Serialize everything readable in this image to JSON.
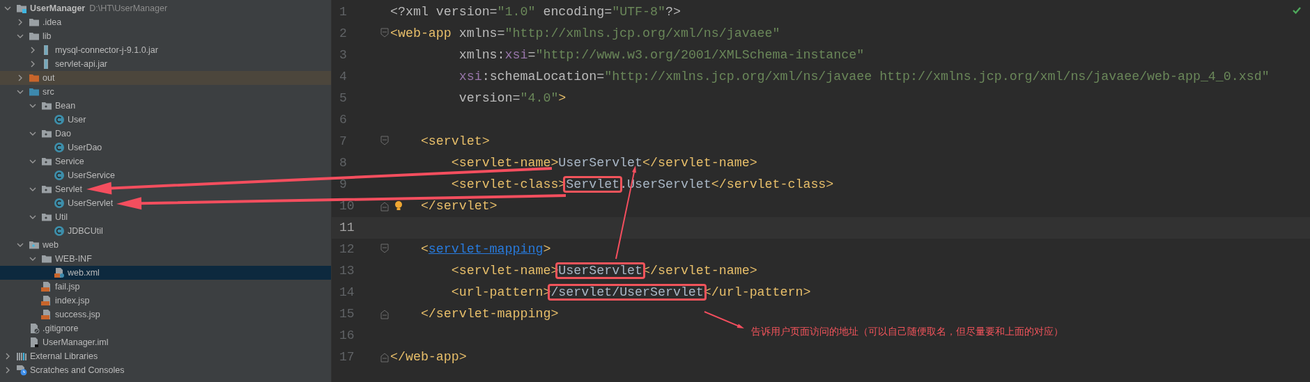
{
  "project_tree": [
    {
      "label": "UserManager",
      "path": "D:\\HT\\UserManager",
      "kind": "module",
      "expanded": true,
      "selected": false,
      "children": [
        {
          "label": ".idea",
          "kind": "folder",
          "expanded": false,
          "selected": false
        },
        {
          "label": "lib",
          "kind": "folder",
          "expanded": true,
          "selected": false,
          "children": [
            {
              "label": "mysql-connector-j-9.1.0.jar",
              "kind": "jar",
              "expanded": false,
              "selected": false
            },
            {
              "label": "servlet-api.jar",
              "kind": "jar",
              "expanded": false,
              "selected": false
            }
          ]
        },
        {
          "label": "out",
          "kind": "excluded-folder",
          "expanded": false,
          "selected": false
        },
        {
          "label": "src",
          "kind": "source-folder",
          "expanded": true,
          "selected": false,
          "children": [
            {
              "label": "Bean",
              "kind": "package",
              "expanded": true,
              "selected": false,
              "children": [
                {
                  "label": "User",
                  "kind": "class",
                  "selected": false
                }
              ]
            },
            {
              "label": "Dao",
              "kind": "package",
              "expanded": true,
              "selected": false,
              "children": [
                {
                  "label": "UserDao",
                  "kind": "class",
                  "selected": false
                }
              ]
            },
            {
              "label": "Service",
              "kind": "package",
              "expanded": true,
              "selected": false,
              "children": [
                {
                  "label": "UserService",
                  "kind": "class",
                  "selected": false
                }
              ]
            },
            {
              "label": "Servlet",
              "kind": "package",
              "expanded": true,
              "selected": false,
              "children": [
                {
                  "label": "UserServlet",
                  "kind": "class",
                  "selected": false
                }
              ]
            },
            {
              "label": "Util",
              "kind": "package",
              "expanded": true,
              "selected": false,
              "children": [
                {
                  "label": "JDBCUtil",
                  "kind": "class",
                  "selected": false
                }
              ]
            }
          ]
        },
        {
          "label": "web",
          "kind": "web-folder",
          "expanded": true,
          "selected": false,
          "children": [
            {
              "label": "WEB-INF",
              "kind": "folder",
              "expanded": true,
              "selected": false,
              "children": [
                {
                  "label": "web.xml",
                  "kind": "xml-file",
                  "selected": true
                }
              ]
            },
            {
              "label": "fail.jsp",
              "kind": "jsp-file",
              "selected": false
            },
            {
              "label": "index.jsp",
              "kind": "jsp-file",
              "selected": false
            },
            {
              "label": "success.jsp",
              "kind": "jsp-file",
              "selected": false
            }
          ]
        },
        {
          "label": ".gitignore",
          "kind": "ignore-file",
          "selected": false
        },
        {
          "label": "UserManager.iml",
          "kind": "module-file",
          "selected": false
        }
      ]
    },
    {
      "label": "External Libraries",
      "kind": "libraries",
      "expanded": false,
      "selected": false
    },
    {
      "label": "Scratches and Consoles",
      "kind": "scratches",
      "expanded": false,
      "selected": false
    }
  ],
  "editor": {
    "lines": [
      {
        "number": "1",
        "current": false,
        "bulb": false,
        "tokens": [
          {
            "kind": "attr",
            "text": "<?xml version=",
            "boxed": false
          },
          {
            "kind": "str",
            "text": "\"1.0\"",
            "boxed": false
          },
          {
            "kind": "attr",
            "text": " encoding=",
            "boxed": false
          },
          {
            "kind": "str",
            "text": "\"UTF-8\"",
            "boxed": false
          },
          {
            "kind": "attr",
            "text": "?>",
            "boxed": false
          }
        ]
      },
      {
        "number": "2",
        "current": false,
        "bulb": false,
        "kind": "fold-start",
        "tokens": [
          {
            "kind": "tag",
            "text": "<web-app",
            "boxed": false
          },
          {
            "kind": "attr",
            "text": " xmlns=",
            "boxed": false
          },
          {
            "kind": "str",
            "text": "\"http://xmlns.jcp.org/xml/ns/javaee\"",
            "boxed": false
          }
        ]
      },
      {
        "number": "3",
        "current": false,
        "bulb": false,
        "tokens": [
          {
            "kind": "attr",
            "text": "         xmlns:",
            "boxed": false
          },
          {
            "kind": "ns",
            "text": "xsi",
            "boxed": false
          },
          {
            "kind": "attr",
            "text": "=",
            "boxed": false
          },
          {
            "kind": "str",
            "text": "\"http://www.w3.org/2001/XMLSchema-instance\"",
            "boxed": false
          }
        ]
      },
      {
        "number": "4",
        "current": false,
        "bulb": false,
        "tokens": [
          {
            "kind": "ns",
            "text": "         xsi",
            "boxed": false
          },
          {
            "kind": "attr",
            "text": ":schemaLocation=",
            "boxed": false
          },
          {
            "kind": "str",
            "text": "\"http://xmlns.jcp.org/xml/ns/javaee http://xmlns.jcp.org/xml/ns/javaee/web-app_4_0.xsd\"",
            "boxed": false
          }
        ]
      },
      {
        "number": "5",
        "current": false,
        "bulb": false,
        "tokens": [
          {
            "kind": "attr",
            "text": "         version=",
            "boxed": false
          },
          {
            "kind": "str",
            "text": "\"4.0\"",
            "boxed": false
          },
          {
            "kind": "tag",
            "text": ">",
            "boxed": false
          }
        ]
      },
      {
        "number": "6",
        "current": false,
        "bulb": false
      },
      {
        "number": "7",
        "current": false,
        "bulb": false,
        "kind": "fold-start",
        "tokens": [
          {
            "kind": "tag",
            "text": "    <servlet>",
            "boxed": false
          }
        ]
      },
      {
        "number": "8",
        "current": false,
        "bulb": false,
        "tokens": [
          {
            "kind": "tag",
            "text": "        <servlet-name>",
            "boxed": false
          },
          {
            "kind": "text",
            "text": "UserServlet",
            "boxed": false
          },
          {
            "kind": "tag",
            "text": "</servlet-name>",
            "boxed": false
          }
        ]
      },
      {
        "number": "9",
        "current": false,
        "bulb": false,
        "tokens": [
          {
            "kind": "tag",
            "text": "        <servlet-class>",
            "boxed": false
          },
          {
            "kind": "text",
            "text": "Servlet",
            "boxed": true
          },
          {
            "kind": "text",
            "text": ".UserServlet",
            "boxed": false
          },
          {
            "kind": "tag",
            "text": "</servlet-class>",
            "boxed": false
          }
        ]
      },
      {
        "number": "10",
        "current": false,
        "bulb": true,
        "kind": "fold-end",
        "tokens": [
          {
            "kind": "tag",
            "text": "    </servlet>",
            "boxed": false
          }
        ]
      },
      {
        "number": "11",
        "current": true,
        "bulb": false
      },
      {
        "number": "12",
        "current": false,
        "bulb": false,
        "kind": "fold-start",
        "tokens": [
          {
            "kind": "tag",
            "text": "    <",
            "boxed": false
          },
          {
            "kind": "link",
            "text": "servlet-mapping",
            "boxed": false
          },
          {
            "kind": "tag",
            "text": ">",
            "boxed": false
          }
        ]
      },
      {
        "number": "13",
        "current": false,
        "bulb": false,
        "tokens": [
          {
            "kind": "tag",
            "text": "        <servlet-name>",
            "boxed": false
          },
          {
            "kind": "text",
            "text": "UserServlet",
            "boxed": true
          },
          {
            "kind": "tag",
            "text": "</servlet-name>",
            "boxed": false
          }
        ]
      },
      {
        "number": "14",
        "current": false,
        "bulb": false,
        "tokens": [
          {
            "kind": "tag",
            "text": "        <url-pattern>",
            "boxed": false
          },
          {
            "kind": "text",
            "text": "/servlet/UserServlet",
            "boxed": true
          },
          {
            "kind": "tag",
            "text": "</url-pattern>",
            "boxed": false
          }
        ]
      },
      {
        "number": "15",
        "current": false,
        "bulb": false,
        "kind": "fold-end",
        "tokens": [
          {
            "kind": "tag",
            "text": "    </servlet-mapping>",
            "boxed": false
          }
        ]
      },
      {
        "number": "16",
        "current": false,
        "bulb": false
      },
      {
        "number": "17",
        "current": false,
        "bulb": false,
        "kind": "fold-end",
        "tokens": [
          {
            "kind": "tag",
            "text": "</web-app>",
            "boxed": false
          }
        ]
      }
    ],
    "note": "告诉用户页面访问的地址（可以自己随便取名，但尽量要和上面的对应）"
  }
}
